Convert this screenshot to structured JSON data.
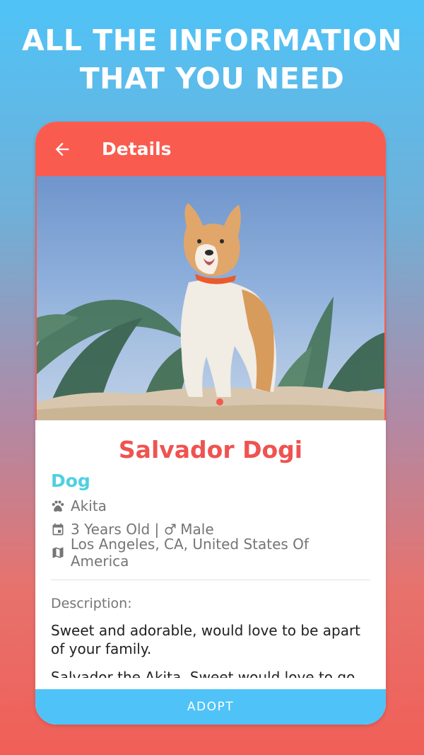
{
  "headline": {
    "line1": "ALL THE INFORMATION",
    "line2": "THAT YOU NEED"
  },
  "appbar": {
    "title": "Details",
    "back_icon": "arrow-left-icon"
  },
  "carousel": {
    "photo": "akita dog standing on sand",
    "dot_color": "#f05a4f"
  },
  "pet": {
    "name": "Salvador Dogi",
    "type": "Dog",
    "breed": "Akita",
    "age_gender_prefix": "3 Years Old |",
    "gender": "Male",
    "location": "Los Angeles, CA, United States Of America"
  },
  "description": {
    "label": "Description:",
    "text": "Sweet and adorable, would  love to be apart of your family.",
    "more": "Salvador the Akita. Sweet would love to go to a home"
  },
  "actions": {
    "adopt": "ADOPT"
  },
  "colors": {
    "accent": "#fa5b4f",
    "name": "#ef5350",
    "type": "#4dd0e1",
    "button": "#4fc3f7"
  }
}
